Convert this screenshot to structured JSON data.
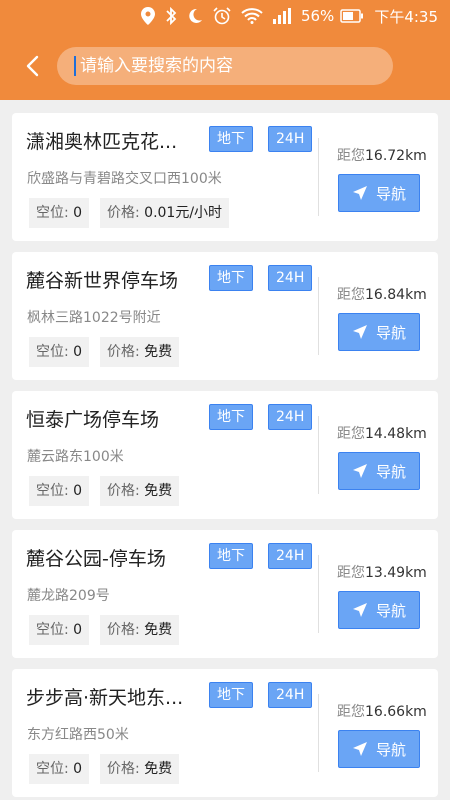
{
  "status_bar": {
    "battery": "56%",
    "time": "下午4:35",
    "icons": [
      "location-icon",
      "bluetooth-icon",
      "moon-icon",
      "alarm-icon",
      "wifi-icon",
      "signal-icon",
      "battery-icon"
    ]
  },
  "search": {
    "placeholder": "请输入要搜索的内容",
    "value": ""
  },
  "colors": {
    "header": "#f08a3c",
    "tag": "#6aa5f5",
    "nav_button": "#6aa5f5"
  },
  "parking_lots": [
    {
      "name": "潇湘奥林匹克花...",
      "tag_type": "地下",
      "tag_hours": "24H",
      "address": "欣盛路与青碧路交叉口西100米",
      "space_label": "空位:",
      "space_value": "0",
      "price_label": "价格:",
      "price_value": "0.01元/小时",
      "distance_label": "距您",
      "distance_value": "16.72km",
      "nav_label": "导航"
    },
    {
      "name": "麓谷新世界停车场",
      "tag_type": "地下",
      "tag_hours": "24H",
      "address": "枫林三路1022号附近",
      "space_label": "空位:",
      "space_value": "0",
      "price_label": "价格:",
      "price_value": "免费",
      "distance_label": "距您",
      "distance_value": "16.84km",
      "nav_label": "导航"
    },
    {
      "name": "恒泰广场停车场",
      "tag_type": "地下",
      "tag_hours": "24H",
      "address": "麓云路东100米",
      "space_label": "空位:",
      "space_value": "0",
      "price_label": "价格:",
      "price_value": "免费",
      "distance_label": "距您",
      "distance_value": "14.48km",
      "nav_label": "导航"
    },
    {
      "name": "麓谷公园-停车场",
      "tag_type": "地下",
      "tag_hours": "24H",
      "address": "麓龙路209号",
      "space_label": "空位:",
      "space_value": "0",
      "price_label": "价格:",
      "price_value": "免费",
      "distance_label": "距您",
      "distance_value": "13.49km",
      "nav_label": "导航"
    },
    {
      "name": "步步高·新天地东...",
      "tag_type": "地下",
      "tag_hours": "24H",
      "address": "东方红路西50米",
      "space_label": "空位:",
      "space_value": "0",
      "price_label": "价格:",
      "price_value": "免费",
      "distance_label": "距您",
      "distance_value": "16.66km",
      "nav_label": "导航"
    }
  ]
}
